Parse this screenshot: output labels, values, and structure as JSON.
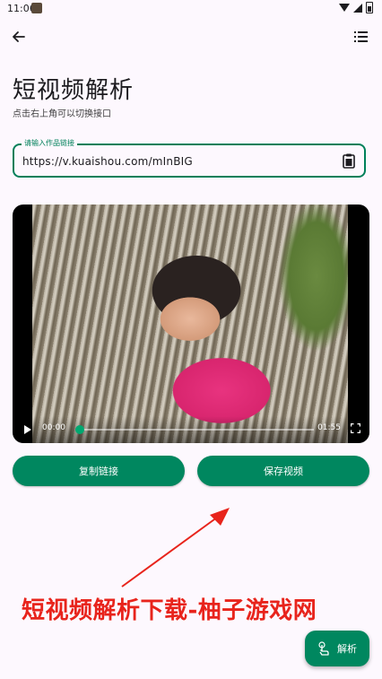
{
  "status_bar": {
    "time": "11:06"
  },
  "header": {
    "title": "短视频解析",
    "subtitle": "点击右上角可以切换接口"
  },
  "url_field": {
    "label": "请输入作品链接",
    "value": "https://v.kuaishou.com/mInBIG"
  },
  "video": {
    "current_time": "00:00",
    "duration": "01:55",
    "progress": 0.02
  },
  "actions": {
    "copy_label": "复制链接",
    "save_label": "保存视频"
  },
  "watermark": {
    "text": "短视频解析下载-柚子游戏网"
  },
  "fab": {
    "label": "解析",
    "icon": "hand-tap-icon"
  },
  "colors": {
    "accent": "#00875f",
    "background": "#fdf8fe",
    "watermark": "#e8241c"
  }
}
